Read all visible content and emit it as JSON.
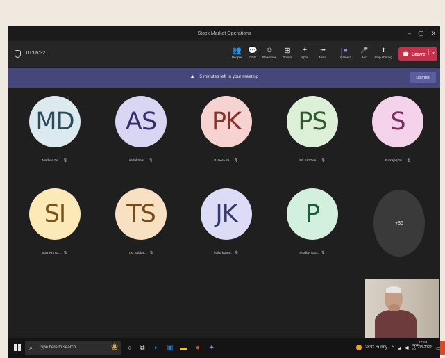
{
  "window": {
    "title": "Stock Market Operations",
    "minimize": "–",
    "maximize": "▢",
    "close": "✕"
  },
  "toolbar": {
    "timer": "01:05:32",
    "buttons": [
      {
        "icon": "people-icon",
        "glyph": "👥",
        "label": "People"
      },
      {
        "icon": "chat-icon",
        "glyph": "💬",
        "label": "Chat"
      },
      {
        "icon": "reactions-icon",
        "glyph": "☺",
        "label": "Reactions"
      },
      {
        "icon": "rooms-icon",
        "glyph": "⊞",
        "label": "Rooms"
      },
      {
        "icon": "apps-icon",
        "glyph": "+",
        "label": "Apps"
      },
      {
        "icon": "more-icon",
        "glyph": "•••",
        "label": "More"
      },
      {
        "icon": "camera-icon",
        "glyph": "■",
        "label": "Camera"
      },
      {
        "icon": "mic-icon",
        "glyph": "🎤",
        "label": "Mic"
      },
      {
        "icon": "share-icon",
        "glyph": "⬆",
        "label": "Stop sharing"
      }
    ],
    "leave_label": "Leave"
  },
  "banner": {
    "message": "5 minutes left in your meeting",
    "dismiss_label": "Dismiss",
    "warning_glyph": "▲"
  },
  "participants": [
    {
      "initials": "MD",
      "name": "Madhan Dn...",
      "bg": "#dce9ee",
      "fg": "#2a4c5a"
    },
    {
      "initials": "AS",
      "name": "Abdul Sam...",
      "bg": "#d9d6f3",
      "fg": "#33306b"
    },
    {
      "initials": "PK",
      "name": "P.Veera Sa...",
      "bg": "#f6d3d0",
      "fg": "#8a2e2a"
    },
    {
      "initials": "PS",
      "name": "PB SIDDHA...",
      "bg": "#dcefd7",
      "fg": "#2f5a2e"
    },
    {
      "initials": "S",
      "name": "Supraja (Gu...",
      "bg": "#f4d3ea",
      "fg": "#7a2c63"
    },
    {
      "initials": "SI",
      "name": "supriya I (G...",
      "bg": "#fbe9b8",
      "fg": "#7a5412"
    },
    {
      "initials": "TS",
      "name": "T.K. Subbar...",
      "bg": "#f8e0c2",
      "fg": "#7a4a17"
    },
    {
      "initials": "JK",
      "name": "j dilip kuma...",
      "bg": "#dcdcf7",
      "fg": "#34366e"
    },
    {
      "initials": "P",
      "name": "Prudhvi (Gu...",
      "bg": "#d3f0de",
      "fg": "#1f5b3b"
    }
  ],
  "overflow_count": "+35",
  "taskbar": {
    "search_placeholder": "Type here to search",
    "weather": "28°C Sunny",
    "time": "12:03",
    "date": "17-08-2022",
    "lang_top": "ENG",
    "lang_bottom": "IN"
  }
}
